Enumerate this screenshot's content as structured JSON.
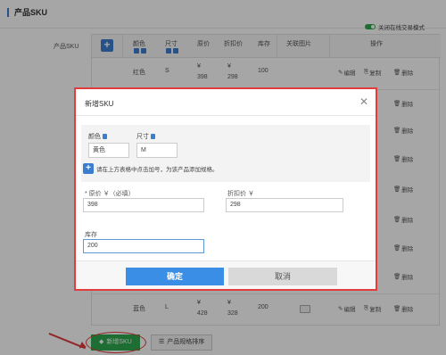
{
  "section": {
    "title": "产品SKU",
    "toggle_label": "关闭在线交易模式"
  },
  "sku_label": "产品SKU",
  "table": {
    "headers": {
      "color": "颜色",
      "size": "尺寸",
      "price": "原价",
      "discount": "折扣价",
      "stock": "库存",
      "image": "关联图片",
      "actions": "操作"
    },
    "rows": [
      {
        "color": "红色",
        "size": "S",
        "price_symbol": "¥",
        "price": "398",
        "discount_symbol": "¥",
        "discount": "298",
        "stock": "100",
        "edit": "编辑",
        "copy": "复制",
        "delete": "删除"
      },
      {
        "color": "蓝色",
        "size": "L",
        "price_symbol": "¥",
        "price": "428",
        "discount_symbol": "¥",
        "discount": "328",
        "stock": "200",
        "edit": "编辑",
        "copy": "复制",
        "delete": "删除"
      }
    ],
    "hidden_row_actions": {
      "copy": "复制",
      "delete": "删除"
    }
  },
  "bottom_buttons": {
    "new_sku": "新增SKU",
    "spec_sort": "产品规格排序"
  },
  "modal": {
    "title": "新增SKU",
    "spec_color_label": "颜色",
    "spec_color_value": "黄色",
    "spec_size_label": "尺寸",
    "spec_size_value": "M",
    "hint": "请在上方表格中点击加号，为该产品添加规格。",
    "price_label": "* 原价 ￥（必填）",
    "price_value": "398",
    "discount_label": "折扣价 ￥",
    "discount_value": "298",
    "stock_label": "库存",
    "stock_value": "200",
    "ok": "确定",
    "cancel": "取消"
  }
}
